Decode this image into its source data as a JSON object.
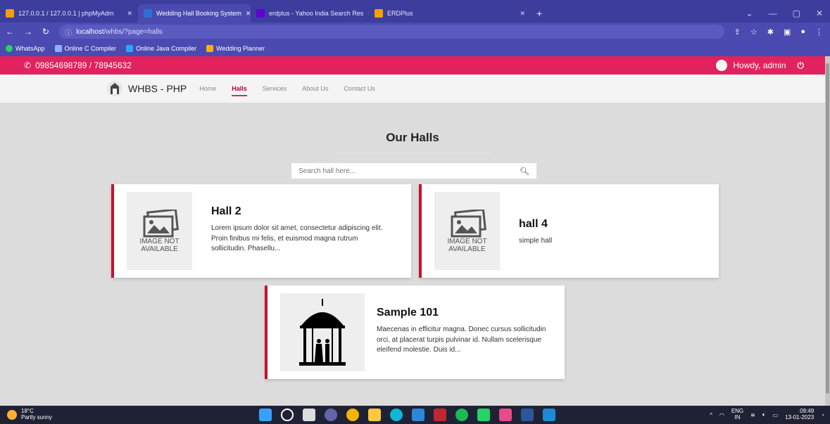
{
  "browser": {
    "tabs": [
      {
        "title": "127.0.0.1 / 127.0.0.1 | phpMyAdm",
        "color": "#f39c12"
      },
      {
        "title": "Wedding Hall Booking System",
        "color": "#2c6fd4"
      },
      {
        "title": "erdplus - Yahoo India Search Res",
        "color": "#6001d2"
      },
      {
        "title": "ERDPlus",
        "color": "#f1a200"
      }
    ],
    "url_host": "localhost",
    "url_path": "/whbs/?page=halls",
    "bookmarks": [
      "WhatsApp",
      "Online C Compiler",
      "Online Java Compiler",
      "Wedding Planner"
    ]
  },
  "topbar": {
    "phone": "09854698789 / 78945632",
    "greeting": "Howdy, admin"
  },
  "navbar": {
    "brand": "WHBS - PHP",
    "links": [
      "Home",
      "Halls",
      "Services",
      "About Us",
      "Contact Us"
    ],
    "active": "Halls"
  },
  "page": {
    "title": "Our Halls",
    "search_placeholder": "Search hall here..."
  },
  "halls": [
    {
      "name": "Hall 2",
      "desc": "Lorem ipsum dolor sit amet, consectetur adipiscing elit. Proin finibus mi felis, et euismod magna rutrum sollicitudin. Phasellu...",
      "image": "IMAGE NOT AVAILABLE"
    },
    {
      "name": "hall 4",
      "desc": "simple hall",
      "image": "IMAGE NOT AVAILABLE"
    },
    {
      "name": "Sample 101",
      "desc": "Maecenas in efficitur magna. Donec cursus sollicitudin orci, at placerat turpis pulvinar id. Nullam scelerisque eleifend molestie. Duis id...",
      "image": "wedding-gazebo"
    }
  ],
  "taskbar": {
    "temp": "18°C",
    "weather": "Partly sunny",
    "lang": "ENG",
    "region": "IN",
    "time": "09:49",
    "date": "13-01-2023"
  },
  "colors": {
    "accent": "#e0235f",
    "browser": "#3d3d9e",
    "card_border": "#c8102e"
  }
}
